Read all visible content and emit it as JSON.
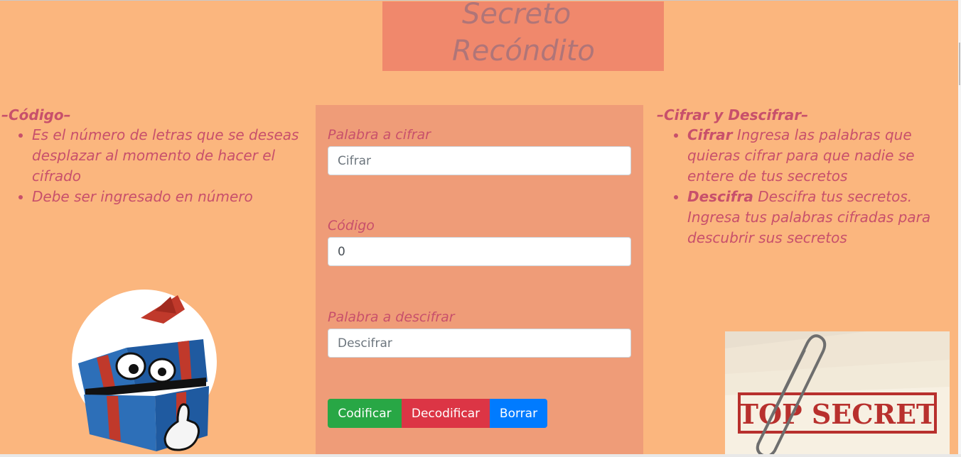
{
  "header": {
    "title_line1": "Secreto",
    "title_line2": "Recóndito"
  },
  "left_panel": {
    "heading": "–Código–",
    "items": [
      "Es el número de letras que se deseas desplazar al momento de hacer el cifrado",
      "Debe ser ingresado en número"
    ]
  },
  "right_panel": {
    "heading": "–Cifrar y Descifrar–",
    "items": [
      {
        "bold": "Cifrar",
        "text": " Ingresa las palabras que quieras cifrar para que nadie se entere de tus secretos"
      },
      {
        "bold": "Descifra",
        "text": " Descifra tus secretos. Ingresa tus palabras cifradas para descubrir sus secretos"
      }
    ]
  },
  "form": {
    "cifrar_label": "Palabra a cifrar",
    "cifrar_placeholder": "Cifrar",
    "codigo_label": "Código",
    "codigo_value": "0",
    "descifrar_label": "Palabra a descifrar",
    "descifrar_placeholder": "Descifrar",
    "codificar_button": "Codificar",
    "decodificar_button": "Decodificar",
    "borrar_button": "Borrar"
  },
  "images": {
    "secret_stamp": "TOP SECRET"
  },
  "colors": {
    "background": "#fbb67e",
    "title_box": "#f0886c",
    "form_panel": "#ef9c78",
    "text_accent": "#c8506b",
    "btn_success": "#28a745",
    "btn_danger": "#dc3545",
    "btn_primary": "#007bff"
  }
}
